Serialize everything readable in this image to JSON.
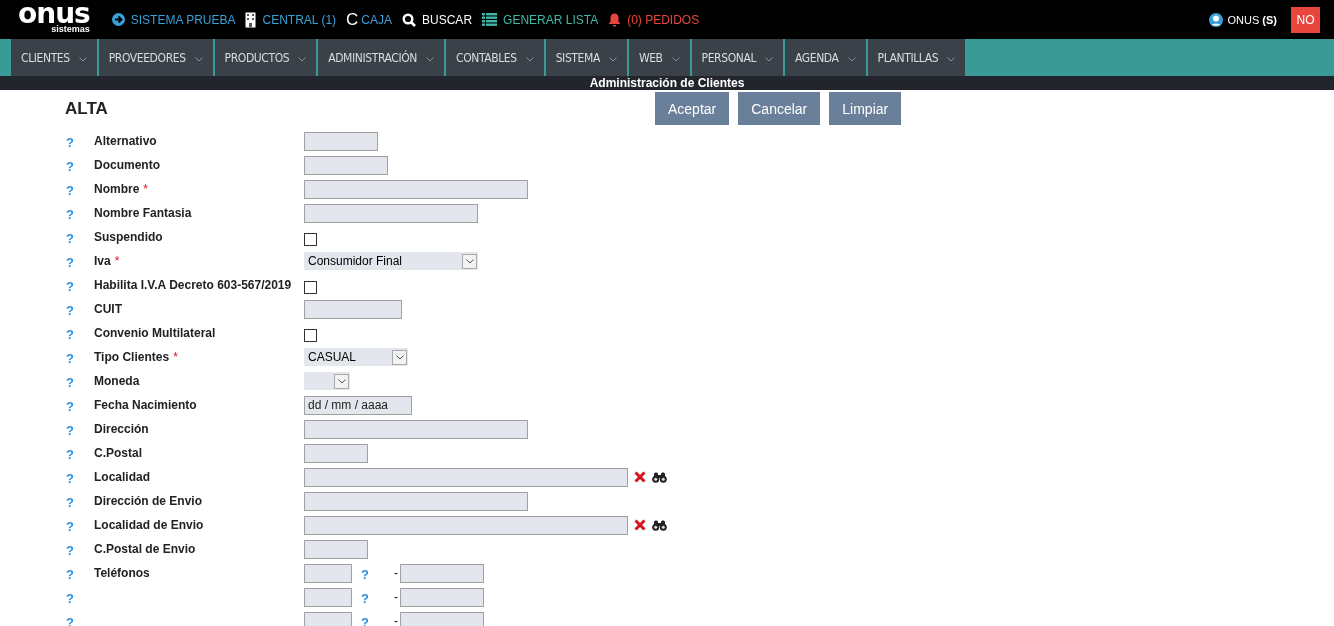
{
  "topbar": {
    "logo": {
      "name": "onus",
      "tagline": "sistemas"
    },
    "links": [
      {
        "kind": "arrow",
        "label": "SISTEMA PRUEBA",
        "color": "#3aa0d8"
      },
      {
        "kind": "building",
        "label": "CENTRAL (1)",
        "color": "#3aa0d8"
      },
      {
        "kind": "letter",
        "glyph": "C",
        "label": "CAJA",
        "color": "#3aa0d8"
      },
      {
        "kind": "search",
        "label": "BUSCAR",
        "color": "#ffffff"
      },
      {
        "kind": "list",
        "label": "GENERAR LISTA",
        "color": "#3fb8a8"
      },
      {
        "kind": "bell",
        "label": "(0) PEDIDOS",
        "color": "#e8463c"
      }
    ],
    "user": {
      "name": "ONUS",
      "suffix": "(S)"
    },
    "exit_button": "NO"
  },
  "menu": [
    {
      "label": "CLIENTES"
    },
    {
      "label": "PROVEEDORES"
    },
    {
      "label": "PRODUCTOS"
    },
    {
      "label": "ADMINISTRACIÓN"
    },
    {
      "label": "CONTABLES"
    },
    {
      "label": "SISTEMA"
    },
    {
      "label": "WEB"
    },
    {
      "label": "PERSONAL"
    },
    {
      "label": "AGENDA"
    },
    {
      "label": "PLANTILLAS"
    }
  ],
  "section_title": "Administración de Clientes",
  "form": {
    "title": "ALTA",
    "buttons": [
      "Aceptar",
      "Cancelar",
      "Limpiar"
    ],
    "help": "?",
    "rows": [
      {
        "kind": "text",
        "label": "Alternativo"
      },
      {
        "kind": "text",
        "label": "Documento"
      },
      {
        "kind": "text",
        "label": "Nombre",
        "required_mark": "*"
      },
      {
        "kind": "text",
        "label": "Nombre Fantasia"
      },
      {
        "kind": "checkbox",
        "label": "Suspendido",
        "checked": false
      },
      {
        "kind": "select",
        "label": "Iva",
        "required_mark": "*",
        "value": "Consumidor Final"
      },
      {
        "kind": "checkbox",
        "label": "Habilita I.V.A Decreto 603-567/2019",
        "checked": false
      },
      {
        "kind": "text",
        "label": "CUIT"
      },
      {
        "kind": "checkbox",
        "label": "Convenio Multilateral",
        "checked": false
      },
      {
        "kind": "select",
        "label": "Tipo Clientes",
        "required_mark": "*",
        "value": "CASUAL"
      },
      {
        "kind": "select",
        "label": "Moneda"
      },
      {
        "kind": "date",
        "label": "Fecha Nacimiento",
        "placeholder": "dd / mm / aaaa"
      },
      {
        "kind": "text",
        "label": "Dirección"
      },
      {
        "kind": "text",
        "label": "C.Postal"
      },
      {
        "kind": "lookup",
        "label": "Localidad"
      },
      {
        "kind": "text",
        "label": "Dirección de Envio"
      },
      {
        "kind": "lookup",
        "label": "Localidad de Envio"
      },
      {
        "kind": "text",
        "label": "C.Postal de Envio"
      },
      {
        "kind": "phone",
        "label": "Teléfonos",
        "separator": "-"
      },
      {
        "kind": "phone",
        "separator": "-"
      },
      {
        "kind": "phone",
        "separator": "-"
      }
    ]
  }
}
